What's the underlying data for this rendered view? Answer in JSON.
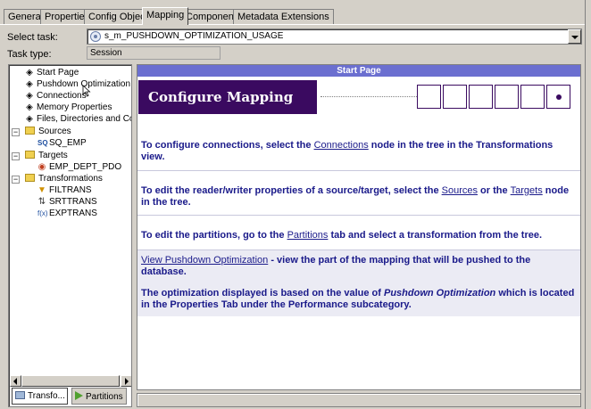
{
  "tabs": [
    {
      "label": "General",
      "active": false
    },
    {
      "label": "Properties",
      "active": false
    },
    {
      "label": "Config Object",
      "active": false
    },
    {
      "label": "Mapping",
      "active": true
    },
    {
      "label": "Components",
      "active": false
    },
    {
      "label": "Metadata Extensions",
      "active": false
    }
  ],
  "select_task": {
    "label": "Select task:",
    "value": "s_m_PUSHDOWN_OPTIMIZATION_USAGE"
  },
  "task_type": {
    "label": "Task type:",
    "value": "Session"
  },
  "tree": {
    "items": [
      {
        "label": "Start Page",
        "icon": "diamond-icon"
      },
      {
        "label": "Pushdown Optimization",
        "icon": "diamond-icon"
      },
      {
        "label": "Connections",
        "icon": "diamond-icon"
      },
      {
        "label": "Memory Properties",
        "icon": "diamond-icon"
      },
      {
        "label": "Files, Directories and Commands",
        "icon": "diamond-icon"
      }
    ],
    "sources": {
      "label": "Sources",
      "children": [
        {
          "label": "SQ_EMP",
          "icon": "source-qualifier-icon"
        }
      ]
    },
    "targets": {
      "label": "Targets",
      "children": [
        {
          "label": "EMP_DEPT_PDO",
          "icon": "target-icon"
        }
      ]
    },
    "transformations": {
      "label": "Transformations",
      "children": [
        {
          "label": "FILTRANS",
          "icon": "filter-icon"
        },
        {
          "label": "SRTTRANS",
          "icon": "sorter-icon"
        },
        {
          "label": "EXPTRANS",
          "icon": "expression-icon"
        }
      ]
    }
  },
  "bottom_tabs": [
    {
      "label": "Transfo...",
      "active": true
    },
    {
      "label": "Partitions",
      "active": false
    }
  ],
  "content": {
    "header": "Start Page",
    "banner_title": "Configure Mapping",
    "steps_total": 6,
    "current_step": 6,
    "sections": {
      "connections": {
        "pre": "To configure connections, select the ",
        "link": "Connections",
        "post": " node in the tree in the Transformations view."
      },
      "reader_writer": {
        "pre": "To edit the reader/writer properties of a source/target, select the ",
        "link1": "Sources",
        "mid": " or the ",
        "link2": "Targets",
        "post": " node in the tree."
      },
      "partitions": {
        "pre": "To edit the partitions, go to the ",
        "link": "Partitions",
        "post": " tab and select a transformation from the tree."
      },
      "pushdown": {
        "link": "View Pushdown Optimization",
        "post": " - view the part of the mapping that will be pushed to the database.",
        "note_pre": "The optimization displayed is based on the value of ",
        "note_em": "Pushdown Optimization",
        "note_post": " which is located in the Properties Tab under the Performance subcategory."
      }
    }
  },
  "colors": {
    "header_bg": "#6b6fd0",
    "banner_bg": "#3a0a60",
    "text": "#1a1a8a",
    "alt_row": "#ebebf4"
  }
}
